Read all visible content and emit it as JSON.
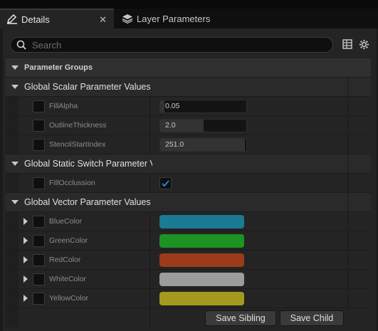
{
  "tabs": [
    {
      "label": "Details",
      "active": true,
      "icon": "pencil-icon"
    },
    {
      "label": "Layer Parameters",
      "active": false,
      "icon": "layers-icon"
    }
  ],
  "close_glyph": "✕",
  "search": {
    "placeholder": "Search",
    "value": ""
  },
  "toolbar_icons": [
    "table-view-icon",
    "settings-gear-icon"
  ],
  "parameter_groups_header": "Parameter Groups",
  "categories": {
    "scalar": "Global Scalar Parameter Values",
    "static_switch": "Global Static Switch Parameter Values",
    "vector": "Global Vector Parameter Values"
  },
  "scalar_params": [
    {
      "name": "FillAlpha",
      "value": "0.05",
      "fill_fraction": 0.05
    },
    {
      "name": "OutlineThickness",
      "value": "2.0",
      "fill_fraction": 0.5
    },
    {
      "name": "StencilStartIndex",
      "value": "251.0",
      "fill_fraction": 0.98
    }
  ],
  "switch_params": [
    {
      "name": "FillOcclussion",
      "checked": true
    }
  ],
  "vector_params": [
    {
      "name": "BlueColor",
      "color": "#1b7a94"
    },
    {
      "name": "GreenColor",
      "color": "#1c9322"
    },
    {
      "name": "RedColor",
      "color": "#9c3b19"
    },
    {
      "name": "WhiteColor",
      "color": "#9c9c9c"
    },
    {
      "name": "YellowColor",
      "color": "#a39a1d"
    }
  ],
  "buttons": {
    "save_sibling": "Save Sibling",
    "save_child": "Save Child"
  },
  "colors": {
    "accent_check": "#2b7fd4",
    "panel_bg": "#242424"
  }
}
